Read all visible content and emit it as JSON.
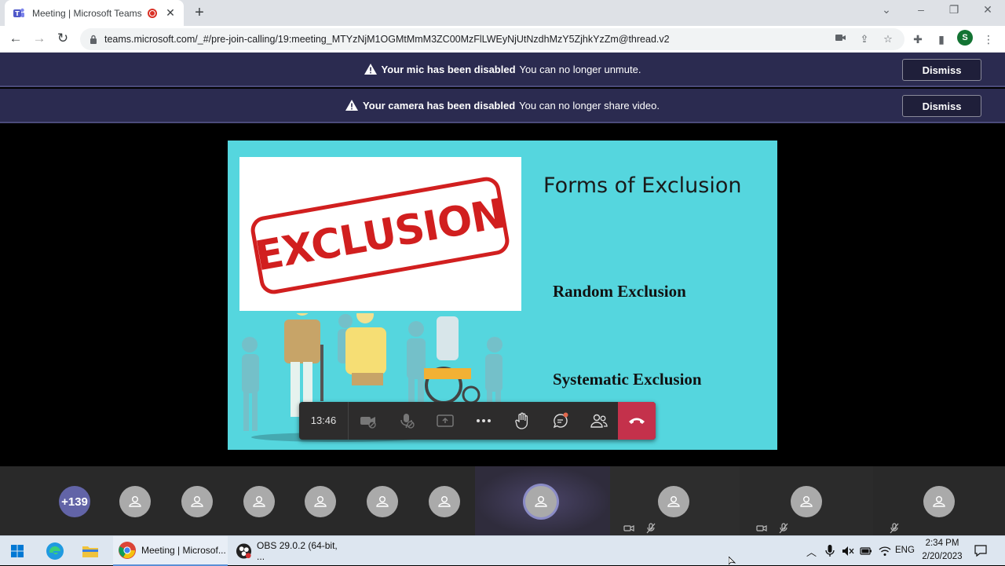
{
  "browser": {
    "tab_title": "Meeting | Microsoft Teams",
    "url": "teams.microsoft.com/_#/pre-join-calling/19:meeting_MTYzNjM1OGMtMmM3ZC00MzFlLWEyNjUtNzdhMzY5ZjhkYzZm@thread.v2",
    "profile_initial": "S"
  },
  "banners": [
    {
      "bold": "Your mic has been disabled",
      "text": "You can no longer unmute.",
      "button": "Dismiss"
    },
    {
      "bold": "Your camera has been disabled",
      "text": "You can no longer share video.",
      "button": "Dismiss"
    }
  ],
  "slide": {
    "title": "Forms of Exclusion",
    "stamp": "EXCLUSION",
    "bullets": [
      "Random Exclusion",
      "Systematic Exclusion"
    ]
  },
  "controls": {
    "timer": "13:46"
  },
  "participants": {
    "overflow_count": "+139"
  },
  "taskbar": {
    "apps": [
      {
        "label": "Meeting | Microsof...",
        "icon": "chrome-icon"
      },
      {
        "label": "OBS 29.0.2 (64-bit, ...",
        "icon": "obs-icon"
      }
    ],
    "lang": "ENG",
    "time": "2:34 PM",
    "date": "2/20/2023"
  },
  "colors": {
    "banner_bg": "#2b2b50",
    "slide_bg": "#55d6de",
    "hangup": "#c4314b",
    "teams_purple": "#6264a7",
    "stamp_red": "#d11f1f"
  }
}
